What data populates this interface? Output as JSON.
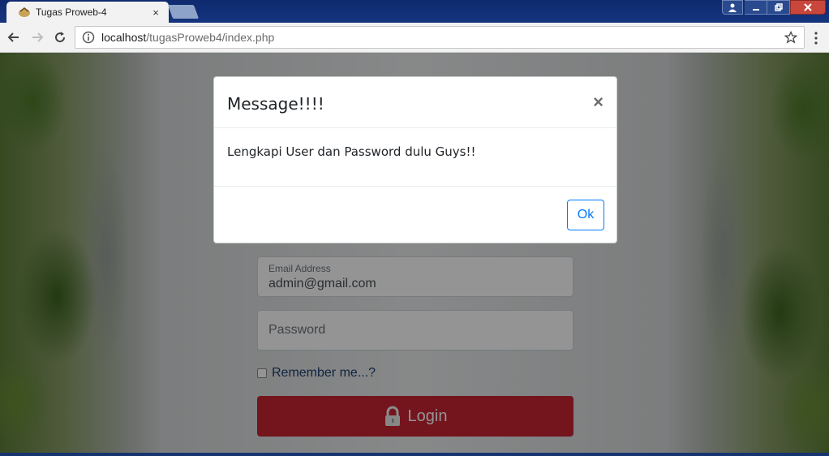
{
  "browser": {
    "tab_title": "Tugas Proweb-4",
    "tab_close": "×",
    "url_host": "localhost",
    "url_path": "/tugasProweb4/index.php"
  },
  "form": {
    "email_label": "Email Address",
    "email_value": "admin@gmail.com",
    "password_placeholder": "Password",
    "remember_label": "Remember me...?",
    "login_label": "Login",
    "login_color": "#c82333"
  },
  "modal": {
    "title": "Message!!!!",
    "close_glyph": "×",
    "message": "Lengkapi User dan Password dulu Guys!!",
    "ok_label": "Ok",
    "ok_color": "#007bff"
  },
  "icons": {
    "back": "arrow-left-icon",
    "forward": "arrow-right-icon",
    "reload": "reload-icon",
    "info": "info-icon",
    "bookmark": "star-icon",
    "menu": "kebab-menu-icon",
    "lock": "lock-icon"
  }
}
